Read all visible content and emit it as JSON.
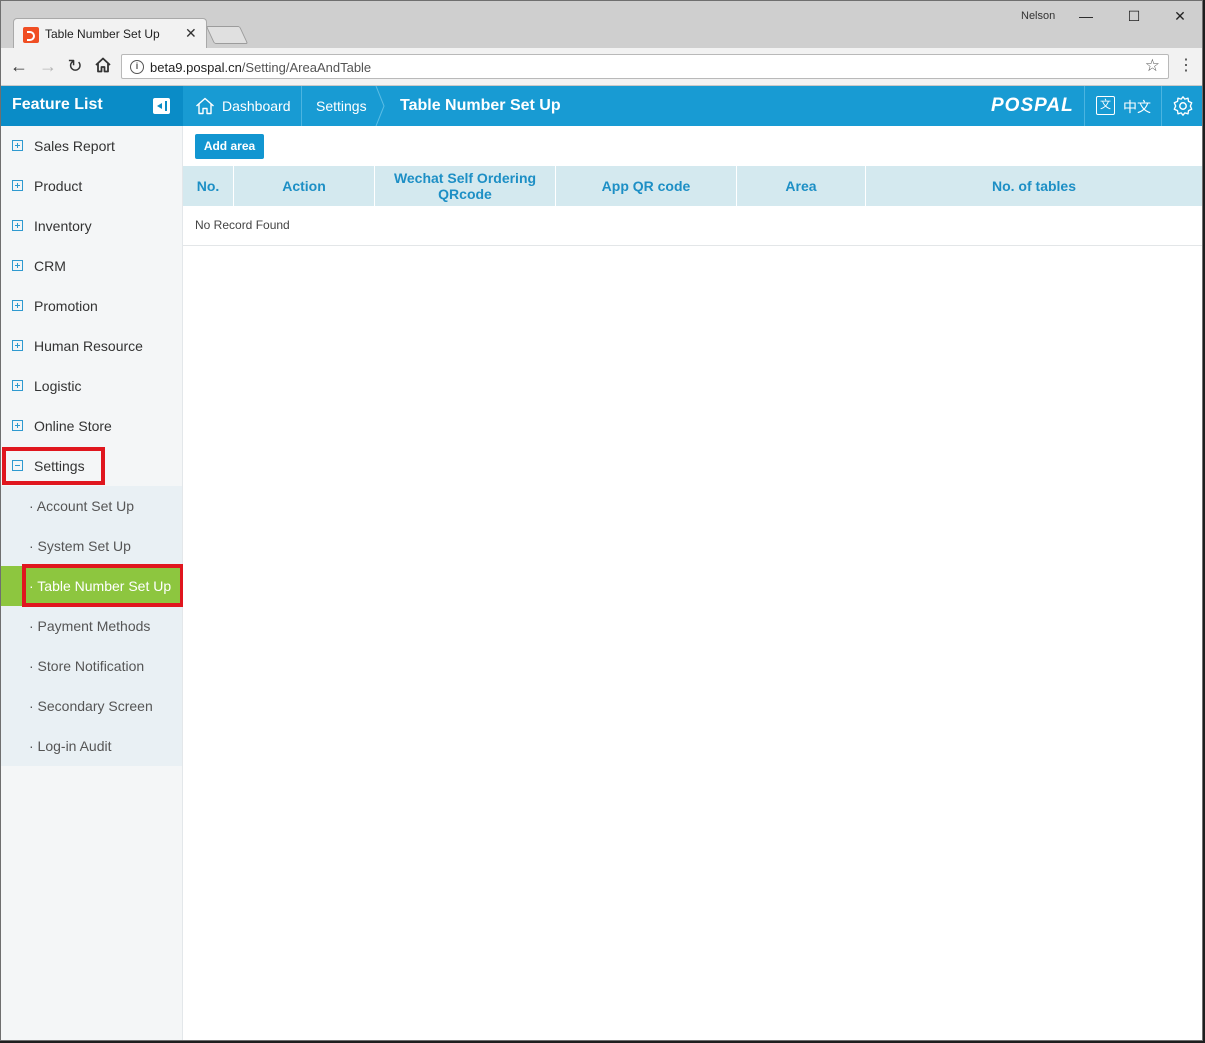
{
  "browser": {
    "tab_title": "Table Number Set Up",
    "close_glyph": "✕",
    "user": "Nelson",
    "url_host": "beta9.pospal.cn",
    "url_path": "/Setting/AreaAndTable"
  },
  "header": {
    "feature_list": "Feature List",
    "breadcrumb": [
      "Dashboard",
      "Settings"
    ],
    "page_title": "Table Number Set Up",
    "logo": "POSPAL",
    "lang_icon_glyph": "文",
    "language": "中文",
    "brand_color": "#189bd3"
  },
  "sidebar": {
    "items": [
      {
        "label": "Sales Report"
      },
      {
        "label": "Product"
      },
      {
        "label": "Inventory"
      },
      {
        "label": "CRM"
      },
      {
        "label": "Promotion"
      },
      {
        "label": "Human Resource"
      },
      {
        "label": "Logistic"
      },
      {
        "label": "Online Store"
      },
      {
        "label": "Settings",
        "expanded": true
      }
    ],
    "subitems": [
      {
        "label": "· Account Set Up"
      },
      {
        "label": "· System Set Up"
      },
      {
        "label": "· Table Number Set Up",
        "active": true
      },
      {
        "label": "· Payment Methods"
      },
      {
        "label": "· Store Notification"
      },
      {
        "label": "· Secondary Screen"
      },
      {
        "label": "· Log-in Audit"
      }
    ],
    "active_color": "#8dc63f",
    "highlight_color": "#e0161e"
  },
  "main": {
    "add_button": "Add area",
    "columns": [
      "No.",
      "Action",
      "Wechat Self Ordering QRcode",
      "App QR code",
      "Area",
      "No. of tables"
    ],
    "empty_text": "No Record Found"
  }
}
